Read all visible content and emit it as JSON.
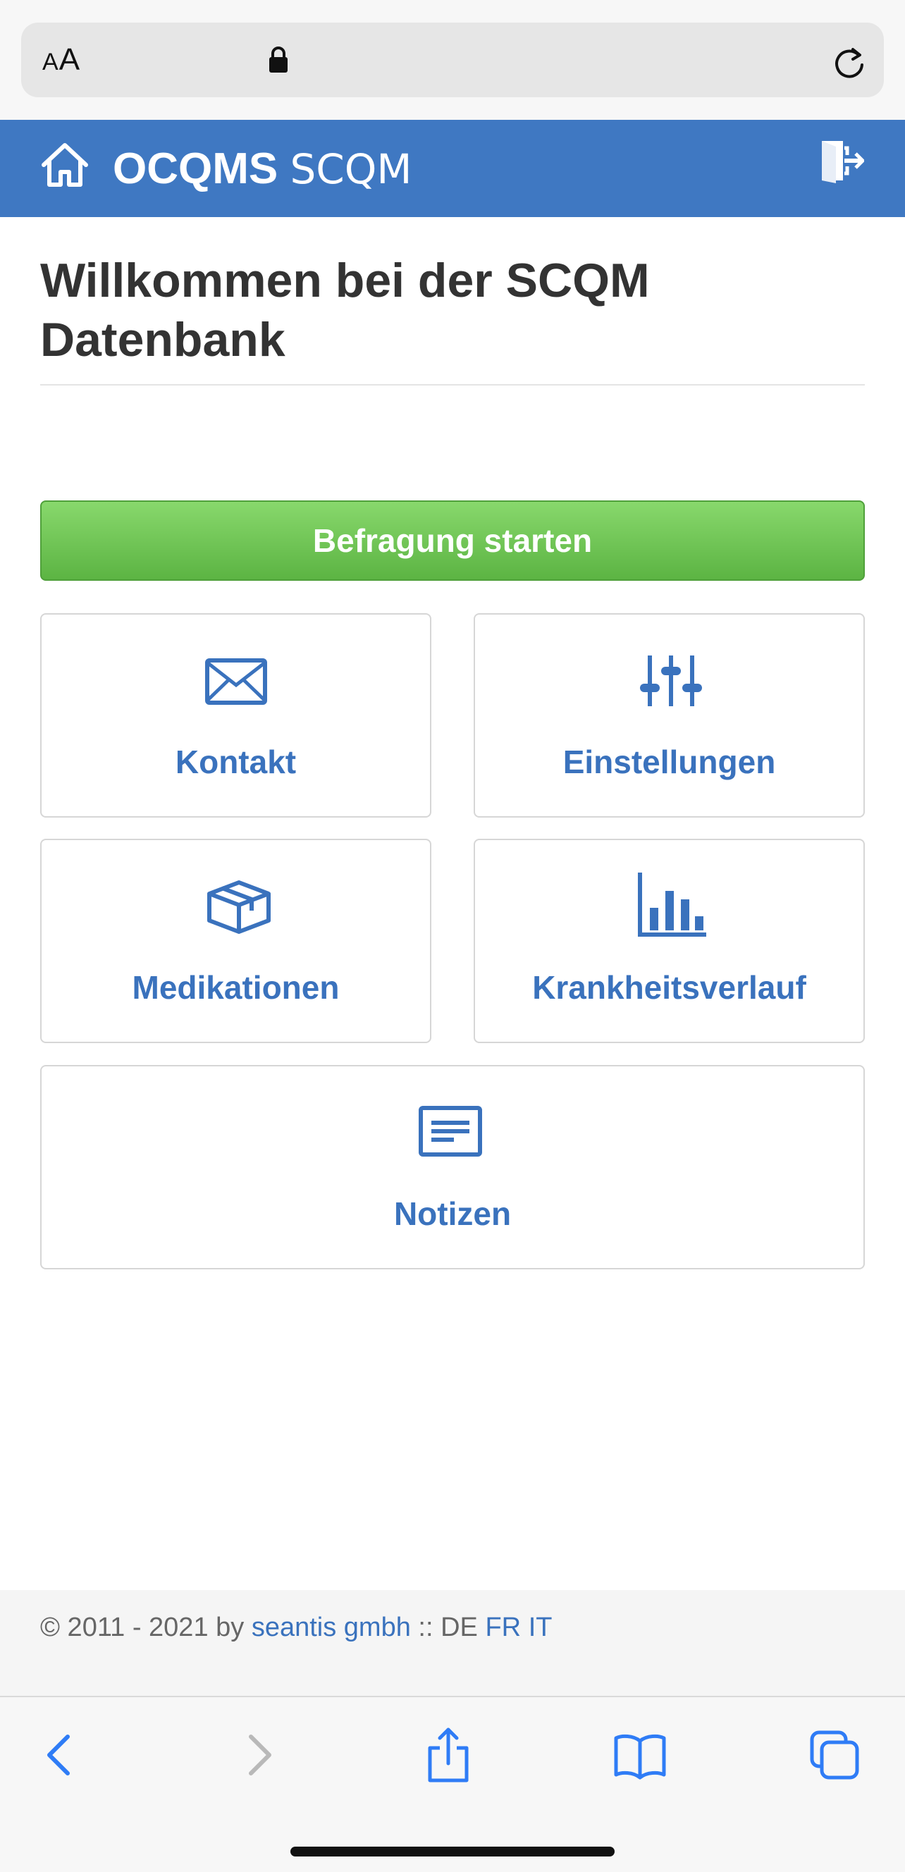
{
  "browser": {
    "text_size_label": "AA",
    "icons": {
      "lock": "lock-icon",
      "reload": "reload-icon"
    }
  },
  "nav": {
    "brand_bold": "OCQMS",
    "brand_light": "SCQM",
    "icons": {
      "home": "home-icon",
      "logout": "logout-icon"
    },
    "color": "#3f78c2"
  },
  "page": {
    "title": "Willkommen bei der SCQM Datenbank",
    "start_button": "Befragung starten",
    "start_button_color": "#5cb443"
  },
  "tiles": [
    {
      "label": "Kontakt",
      "icon": "envelope-icon"
    },
    {
      "label": "Einstellungen",
      "icon": "sliders-icon"
    },
    {
      "label": "Medikationen",
      "icon": "box-icon"
    },
    {
      "label": "Krankheitsverlauf",
      "icon": "bar-chart-icon"
    },
    {
      "label": "Notizen",
      "icon": "notes-icon"
    }
  ],
  "tile_text_color": "#3a72bd",
  "footer": {
    "copyright": "© 2011 - 2021 by",
    "company": "seantis gmbh",
    "separator": "::",
    "lang_current": "DE",
    "lang_fr": "FR",
    "lang_it": "IT"
  },
  "toolbar": {
    "icons": [
      "back-icon",
      "forward-icon",
      "share-icon",
      "bookmarks-icon",
      "tabs-icon"
    ]
  }
}
